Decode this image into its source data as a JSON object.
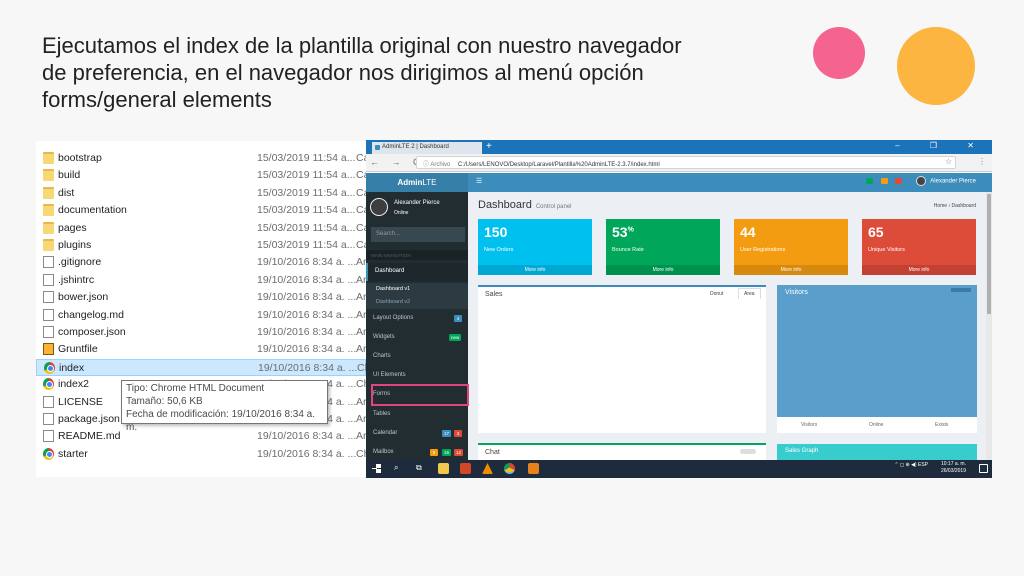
{
  "slide": {
    "title": "Ejecutamos el index  de la plantilla original con nuestro navegador de preferencia, en el navegador nos dirigimos al menú opción forms/general elements"
  },
  "explorer": {
    "files": [
      {
        "name": "bootstrap",
        "date": "15/03/2019 11:54 a...",
        "type": "Ca",
        "icon": "folder-icon"
      },
      {
        "name": "build",
        "date": "15/03/2019 11:54 a...",
        "type": "Ca",
        "icon": "folder-icon"
      },
      {
        "name": "dist",
        "date": "15/03/2019 11:54 a...",
        "type": "Ca",
        "icon": "folder-icon"
      },
      {
        "name": "documentation",
        "date": "15/03/2019 11:54 a...",
        "type": "Ca",
        "icon": "folder-icon"
      },
      {
        "name": "pages",
        "date": "15/03/2019 11:54 a...",
        "type": "Ca",
        "icon": "folder-icon"
      },
      {
        "name": "plugins",
        "date": "15/03/2019 11:54 a...",
        "type": "Ca",
        "icon": "folder-icon"
      },
      {
        "name": ".gitignore",
        "date": "19/10/2016 8:34 a. ...",
        "type": "Ar",
        "icon": "file-icon"
      },
      {
        "name": ".jshintrc",
        "date": "19/10/2016 8:34 a. ...",
        "type": "Ar",
        "icon": "file-icon"
      },
      {
        "name": "bower.json",
        "date": "19/10/2016 8:34 a. ...",
        "type": "Ar",
        "icon": "file-icon"
      },
      {
        "name": "changelog.md",
        "date": "19/10/2016 8:34 a. ...",
        "type": "Ar",
        "icon": "file-icon"
      },
      {
        "name": "composer.json",
        "date": "19/10/2016 8:34 a. ...",
        "type": "Ar",
        "icon": "file-icon"
      },
      {
        "name": "Gruntfile",
        "date": "19/10/2016 8:34 a. ...",
        "type": "Ar",
        "icon": "grunt-icon"
      },
      {
        "name": "index",
        "date": "19/10/2016 8:34 a. ...",
        "type": "Ch",
        "icon": "chrome-icon",
        "selected": true
      },
      {
        "name": "index2",
        "date": "19/10/2016 8:34 a. ...",
        "type": "Ch",
        "icon": "chrome-icon"
      },
      {
        "name": "LICENSE",
        "date": "19/10/2016 8:34 a. ...",
        "type": "Ar",
        "icon": "file-icon"
      },
      {
        "name": "package.json",
        "date": "19/10/2016 8:34 a. ...",
        "type": "Ar",
        "icon": "file-icon"
      },
      {
        "name": "README.md",
        "date": "19/10/2016 8:34 a. ...",
        "type": "Ar",
        "icon": "file-icon"
      },
      {
        "name": "starter",
        "date": "19/10/2016 8:34 a. ...",
        "type": "Ch",
        "icon": "chrome-icon"
      }
    ],
    "tooltip": {
      "type": "Tipo: Chrome HTML Document",
      "size": "Tamaño: 50,6 KB",
      "modified": "Fecha de modificación: 19/10/2016 8:34 a. m."
    }
  },
  "browser": {
    "tab_title": "AdminLTE 2 | Dashboard",
    "new_tab": "+",
    "window_controls": "– ❐ ✕",
    "nav_arrows": "← → C",
    "url_protocol": "ⓘ Archivo",
    "url": "C:/Users/LENOVO/Desktop/Laravel/Plantilla%20AdminLTE-2.3.7/index.html",
    "star": "☆",
    "menu_dots": "⋮"
  },
  "admin": {
    "logo_bold": "Admin",
    "logo_normal": "LTE",
    "user_name": "Alexander Pierce",
    "user_status": "Online",
    "top_user": "Alexander Pierce",
    "search_placeholder": "Search...",
    "nav_header": "MAIN NAVIGATION",
    "menu": {
      "dashboard": "Dashboard",
      "dashboard_v1": "Dashboard v1",
      "dashboard_v2": "Dashboard v2",
      "layout_options": "Layout Options",
      "layout_badge": "4",
      "widgets": "Widgets",
      "widgets_badge": "new",
      "charts": "Charts",
      "ui_elements": "UI Elements",
      "forms": "Forms",
      "tables": "Tables",
      "calendar": "Calendar",
      "calendar_badges": [
        "17",
        "3"
      ],
      "mailbox": "Mailbox",
      "mailbox_badges": [
        "5",
        "16",
        "12"
      ]
    },
    "page_title": "Dashboard",
    "page_subtitle": "Control panel",
    "breadcrumb": "Home  ›  Dashboard",
    "boxes": [
      {
        "value": "150",
        "sup": "",
        "label": "New Orders",
        "more": "More info",
        "color": "#00c0ef"
      },
      {
        "value": "53",
        "sup": "%",
        "label": "Bounce Rate",
        "more": "More info",
        "color": "#00a65a"
      },
      {
        "value": "44",
        "sup": "",
        "label": "User Registrations",
        "more": "More info",
        "color": "#f39c12"
      },
      {
        "value": "65",
        "sup": "",
        "label": "Unique Visitors",
        "more": "More info",
        "color": "#dd4b39"
      }
    ],
    "sales": {
      "title": "Sales",
      "tab_donut": "Donut",
      "tab_area": "Area"
    },
    "chat": {
      "title": "Chat"
    },
    "visitors": {
      "title": "Visitors",
      "footer": [
        "Visitors",
        "Online",
        "Exists"
      ]
    },
    "sales_graph": "Sales Graph"
  },
  "taskbar": {
    "tray": "⌃  ◻  ⊕  ◀)  ESP",
    "time": "10:17 a. m.",
    "date": "26/03/2019"
  }
}
